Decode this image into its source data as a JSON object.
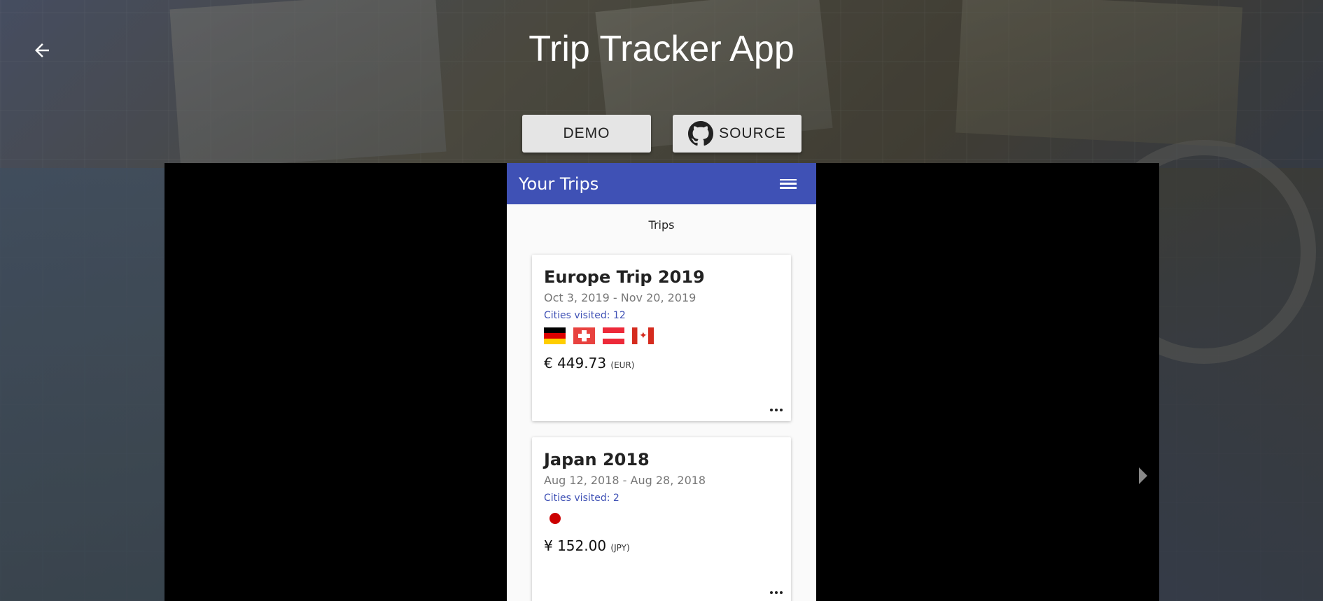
{
  "header": {
    "title": "Trip Tracker App",
    "demo_label": "DEMO",
    "source_label": "SOURCE"
  },
  "app": {
    "appbar_title": "Your Trips",
    "section_label": "Trips",
    "accent_color": "#3f51b5",
    "trips": [
      {
        "name": "Europe Trip 2019",
        "dates": "Oct 3, 2019 - Nov 20, 2019",
        "cities": "Cities visited: 12",
        "flags": [
          "germany-flag",
          "switzerland-flag",
          "austria-flag",
          "canada-flag"
        ],
        "amount": "€ 449.73",
        "currency": "(EUR)"
      },
      {
        "name": "Japan 2018",
        "dates": "Aug 12, 2018 - Aug 28, 2018",
        "cities": "Cities visited: 2",
        "flags": [
          "japan-flag"
        ],
        "amount": "¥ 152.00",
        "currency": "(JPY)"
      }
    ]
  }
}
